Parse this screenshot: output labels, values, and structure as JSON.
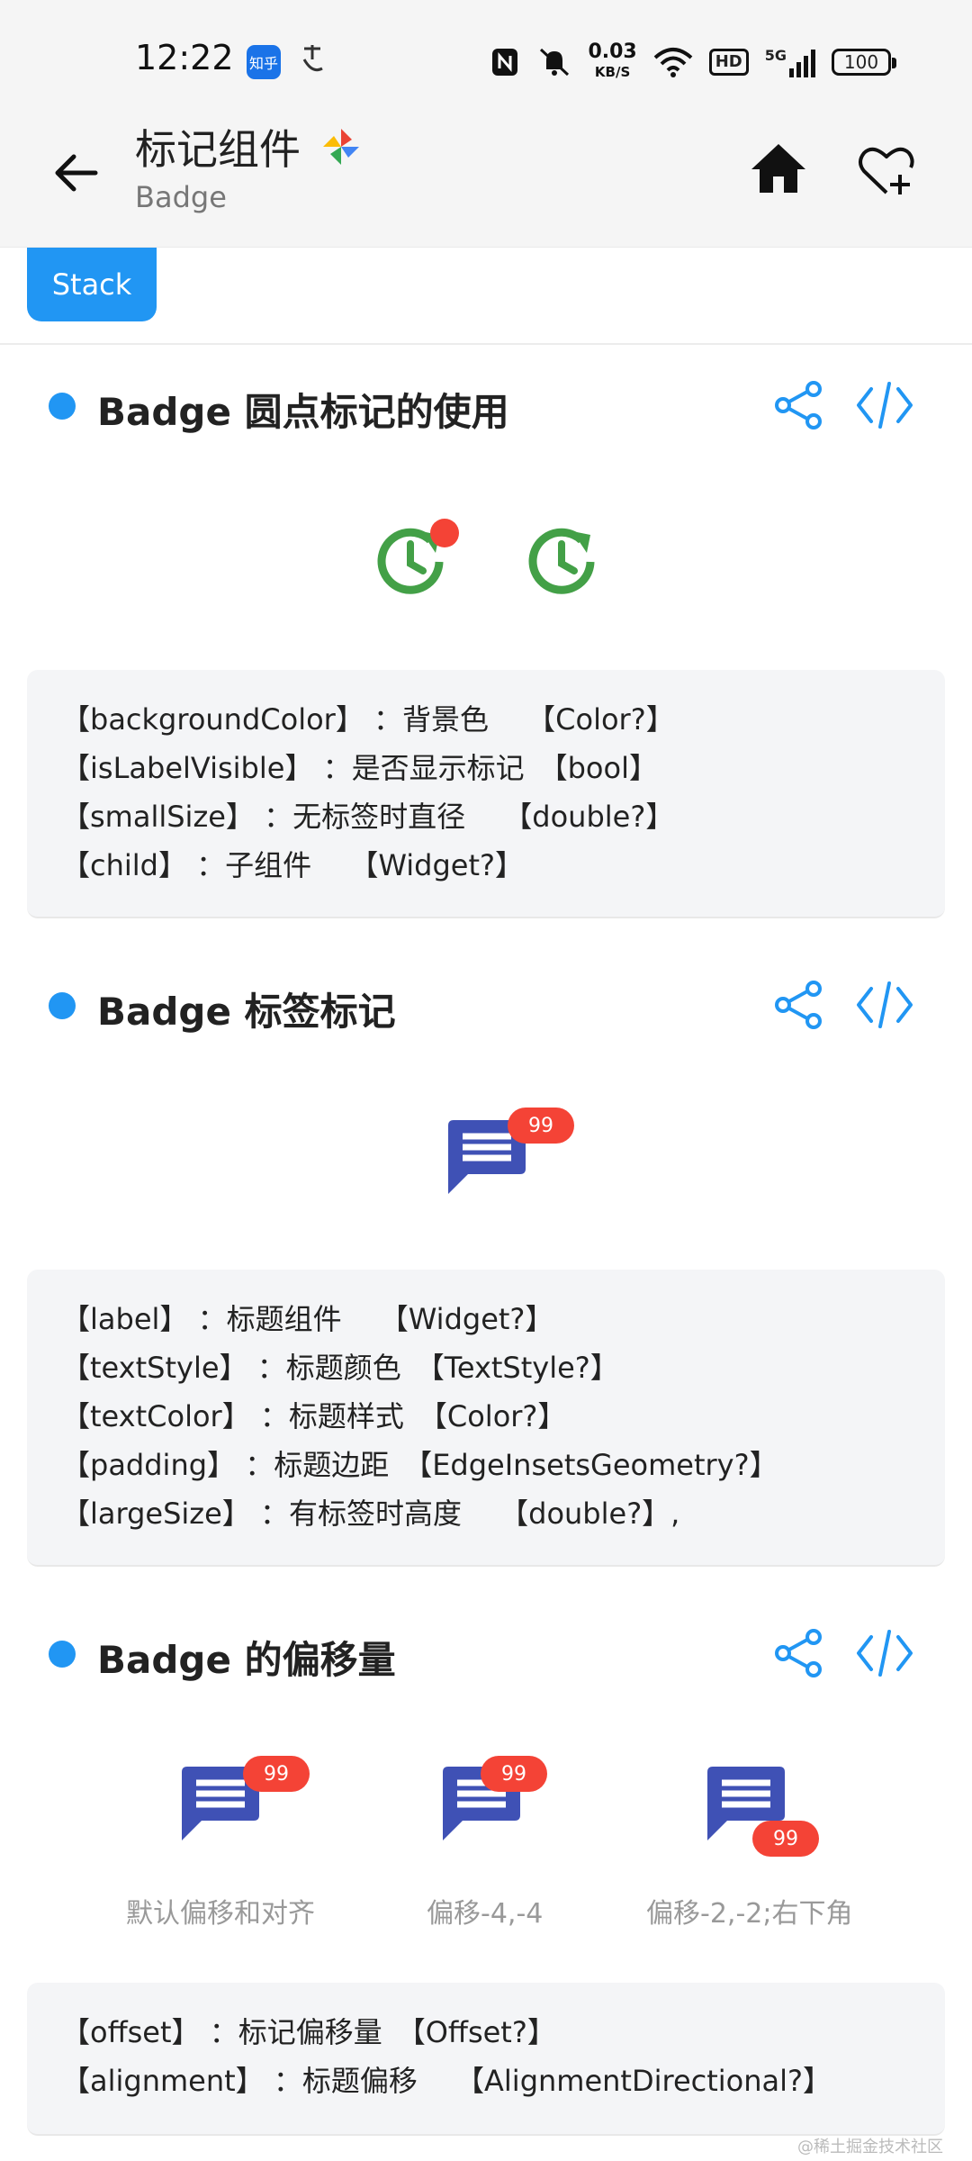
{
  "status_bar": {
    "time": "12:22",
    "app_icon": "知乎",
    "net_speed_value": "0.03",
    "net_speed_unit": "KB/S",
    "hd_label": "HD",
    "signal_label": "5G",
    "battery": "100"
  },
  "app_bar": {
    "title": "标记组件",
    "subtitle": "Badge"
  },
  "chip": {
    "label": "Stack"
  },
  "sections": [
    {
      "title": "Badge 圆点标记的使用",
      "props": [
        "【backgroundColor】 ：背景色　 【Color?】",
        "【isLabelVisible】 ：是否显示标记　【bool】",
        "【smallSize】 ：无标签时直径　 【double?】",
        "【child】 ：子组件　 【Widget?】"
      ]
    },
    {
      "title": "Badge 标签标记",
      "badge_count": "99",
      "props": [
        "【label】 ：标题组件　 【Widget?】",
        "【textStyle】 ：标题颜色　【TextStyle?】",
        "【textColor】 ：标题样式　【Color?】",
        "【padding】 ：标题边距　【EdgeInsetsGeometry?】",
        "【largeSize】 ：有标签时高度　 【double?】,"
      ]
    },
    {
      "title": "Badge 的偏移量",
      "demos": [
        {
          "count": "99",
          "caption": "默认偏移和对齐"
        },
        {
          "count": "99",
          "caption": "偏移-4,-4"
        },
        {
          "count": "99",
          "caption": "偏移-2,-2;右下角"
        }
      ],
      "props": [
        "【offset】 ：标记偏移量　【Offset?】",
        "【alignment】 ：标题偏移　 【AlignmentDirectional?】"
      ]
    }
  ],
  "watermark": "@稀土掘金技术社区",
  "colors": {
    "accent": "#2196f3",
    "badge_red": "#f44336",
    "clock_green": "#43a047",
    "message_indigo": "#3f51b5"
  }
}
